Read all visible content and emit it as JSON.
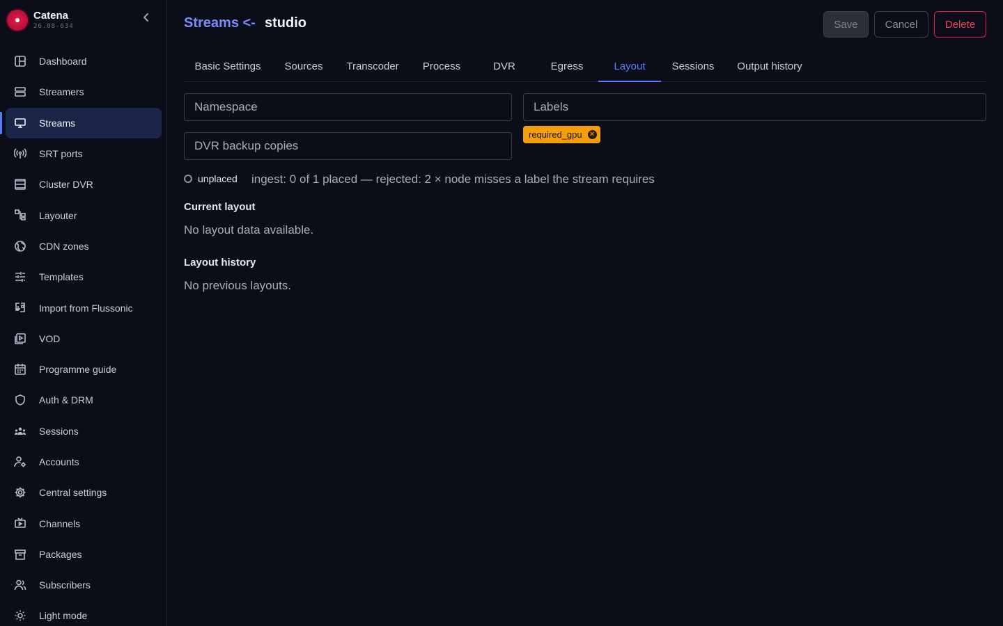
{
  "brand": {
    "name": "Catena",
    "version": "26.08-634"
  },
  "sidebar": {
    "items": [
      {
        "label": "Dashboard",
        "icon": "dashboard-icon"
      },
      {
        "label": "Streamers",
        "icon": "server-icon"
      },
      {
        "label": "Streams",
        "icon": "monitor-icon",
        "active": true
      },
      {
        "label": "SRT ports",
        "icon": "antenna-icon"
      },
      {
        "label": "Cluster DVR",
        "icon": "storage-icon"
      },
      {
        "label": "Layouter",
        "icon": "layout-icon"
      },
      {
        "label": "CDN zones",
        "icon": "globe-icon"
      },
      {
        "label": "Templates",
        "icon": "sliders-icon"
      },
      {
        "label": "Import from Flussonic",
        "icon": "import-icon"
      },
      {
        "label": "VOD",
        "icon": "video-library-icon"
      },
      {
        "label": "Programme guide",
        "icon": "calendar-icon"
      },
      {
        "label": "Auth & DRM",
        "icon": "shield-icon"
      },
      {
        "label": "Sessions",
        "icon": "group-icon"
      },
      {
        "label": "Accounts",
        "icon": "user-gear-icon"
      },
      {
        "label": "Central settings",
        "icon": "gear-icon"
      },
      {
        "label": "Channels",
        "icon": "tv-icon"
      },
      {
        "label": "Packages",
        "icon": "archive-icon"
      },
      {
        "label": "Subscribers",
        "icon": "users-icon"
      },
      {
        "label": "Light mode",
        "icon": "sun-icon"
      }
    ]
  },
  "header": {
    "breadcrumb": "Streams <-",
    "stream_name": "studio",
    "save_label": "Save",
    "cancel_label": "Cancel",
    "delete_label": "Delete"
  },
  "tabs": [
    {
      "label": "Basic Settings"
    },
    {
      "label": "Sources"
    },
    {
      "label": "Transcoder"
    },
    {
      "label": "Process"
    },
    {
      "label": "DVR"
    },
    {
      "label": "Egress"
    },
    {
      "label": "Layout",
      "active": true
    },
    {
      "label": "Sessions"
    },
    {
      "label": "Output history"
    }
  ],
  "form": {
    "namespace_placeholder": "Namespace",
    "labels_placeholder": "Labels",
    "dvr_backup_placeholder": "DVR backup copies",
    "label_chips": [
      "required_gpu"
    ]
  },
  "placement": {
    "status": "unplaced",
    "summary": "ingest: 0 of 1 placed — rejected: 2 × node misses a label the stream requires"
  },
  "current_layout": {
    "title": "Current layout",
    "empty_text": "No layout data available."
  },
  "layout_history": {
    "title": "Layout history",
    "empty_text": "No previous layouts."
  },
  "colors": {
    "accent": "#5b7cfa",
    "chip": "#f59e0b",
    "danger": "#e11d48",
    "background": "#0b0e18"
  }
}
